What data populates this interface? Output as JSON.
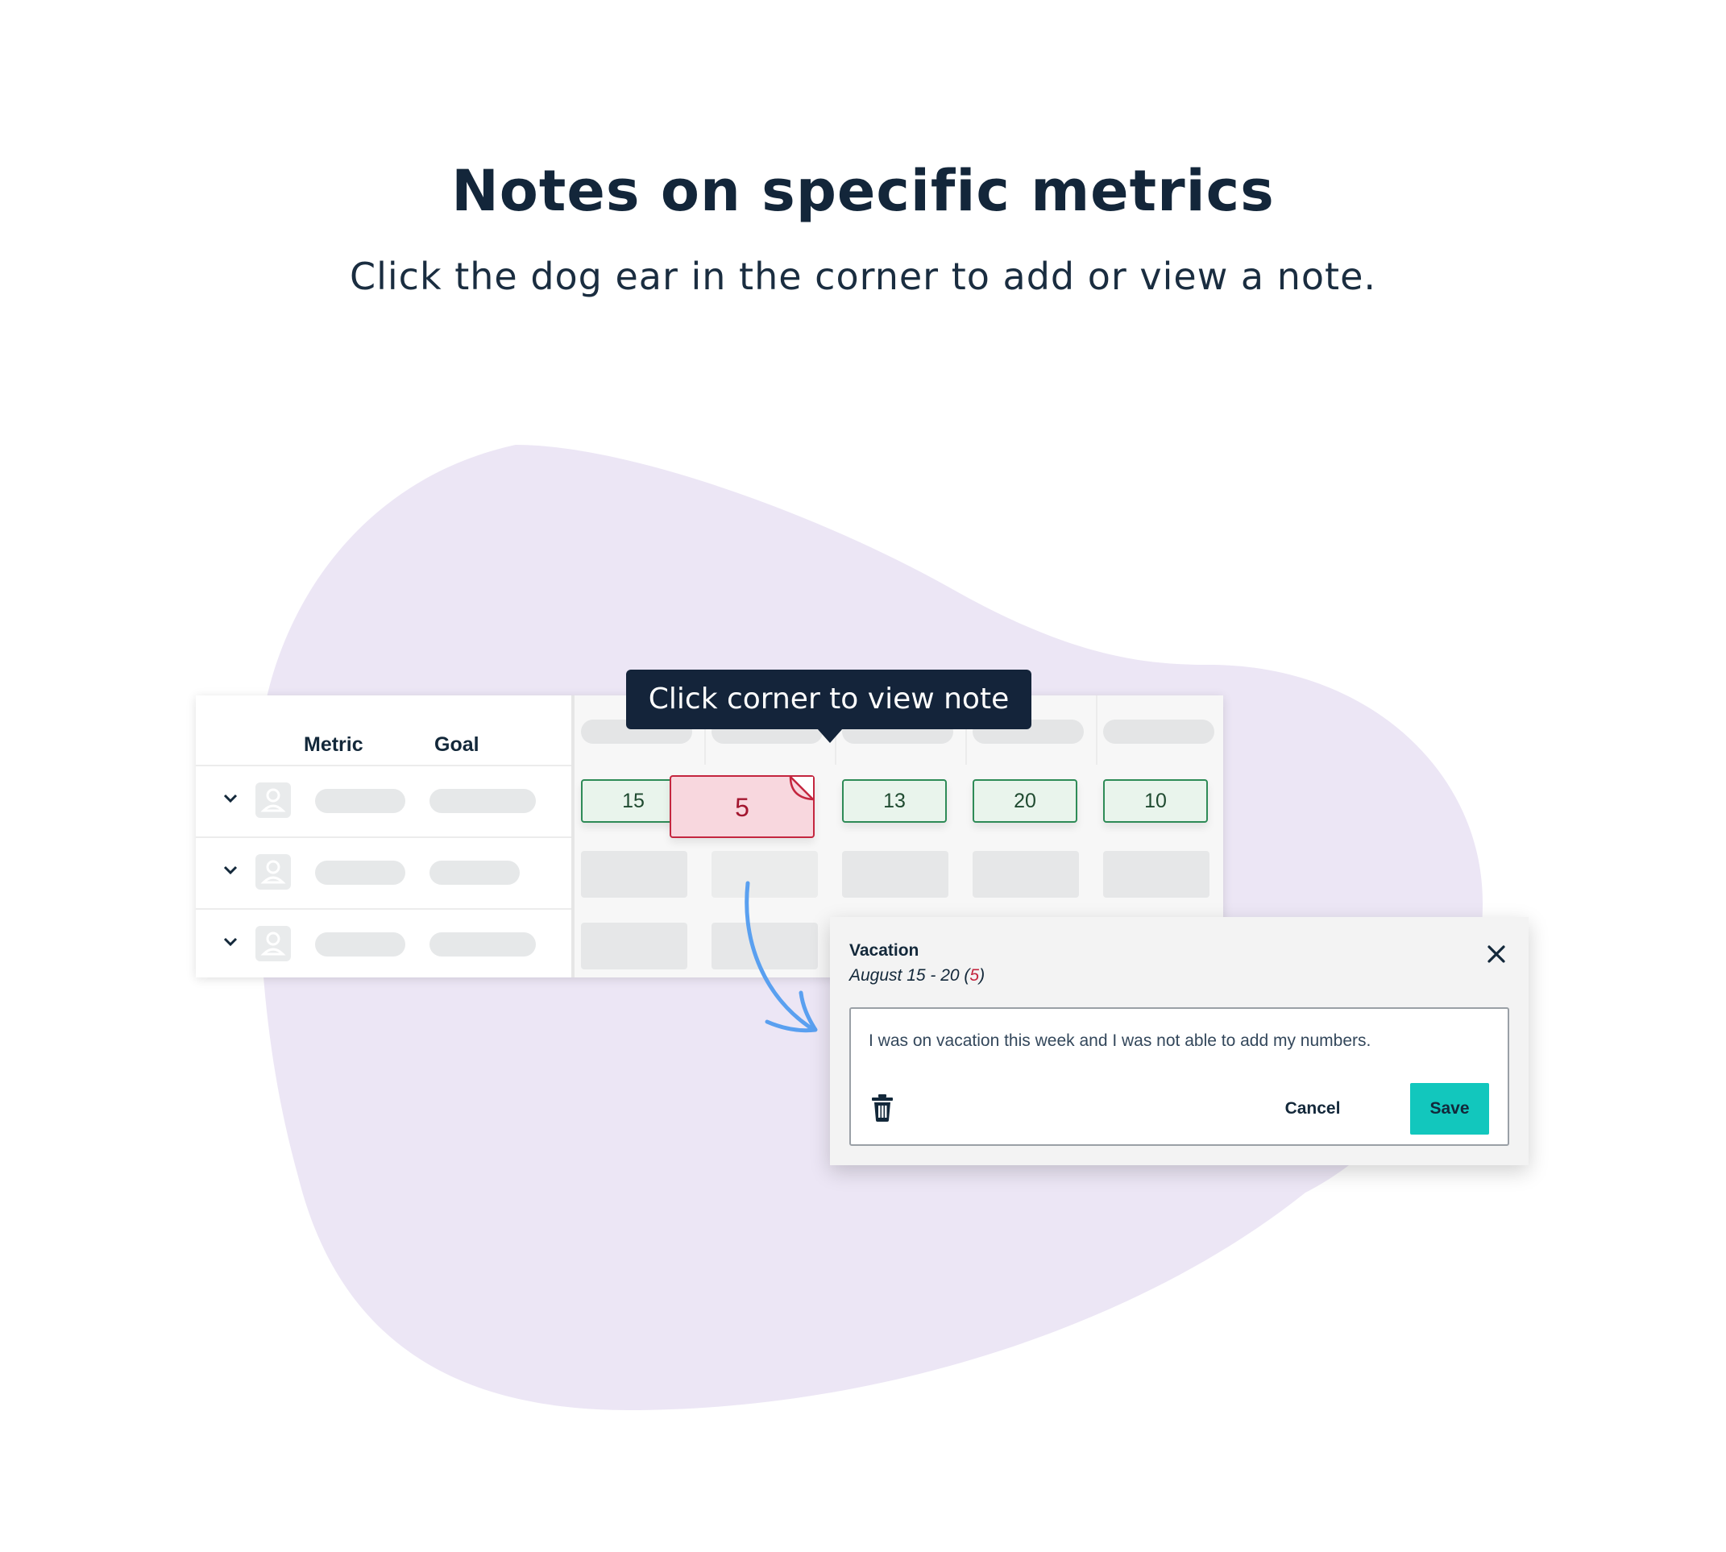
{
  "header": {
    "title": "Notes on specific metrics",
    "subtitle": "Click the dog ear in the corner to add or view a note."
  },
  "table": {
    "columns": {
      "metric": "Metric",
      "goal": "Goal"
    },
    "values": [
      "15",
      "5",
      "13",
      "20",
      "10"
    ],
    "flagged_value_index": 1
  },
  "tooltip": {
    "text": "Click corner to view note"
  },
  "note": {
    "title": "Vacation",
    "date_prefix": "August 15 - 20 (",
    "date_value": "5",
    "date_suffix": ")",
    "body": "I was on vacation this week and I was not able to add my numbers.",
    "cancel_label": "Cancel",
    "save_label": "Save"
  },
  "colors": {
    "blob": "#ece6f5",
    "on_track": "#2e8b57",
    "off_track": "#c4263f",
    "save_button": "#12c7bd",
    "tooltip": "#14243a",
    "arrow": "#5aa0f0"
  },
  "icons": [
    "chevron-down-icon",
    "user-avatar-icon",
    "dog-ear-icon",
    "close-icon",
    "trash-icon",
    "curved-arrow-icon"
  ]
}
